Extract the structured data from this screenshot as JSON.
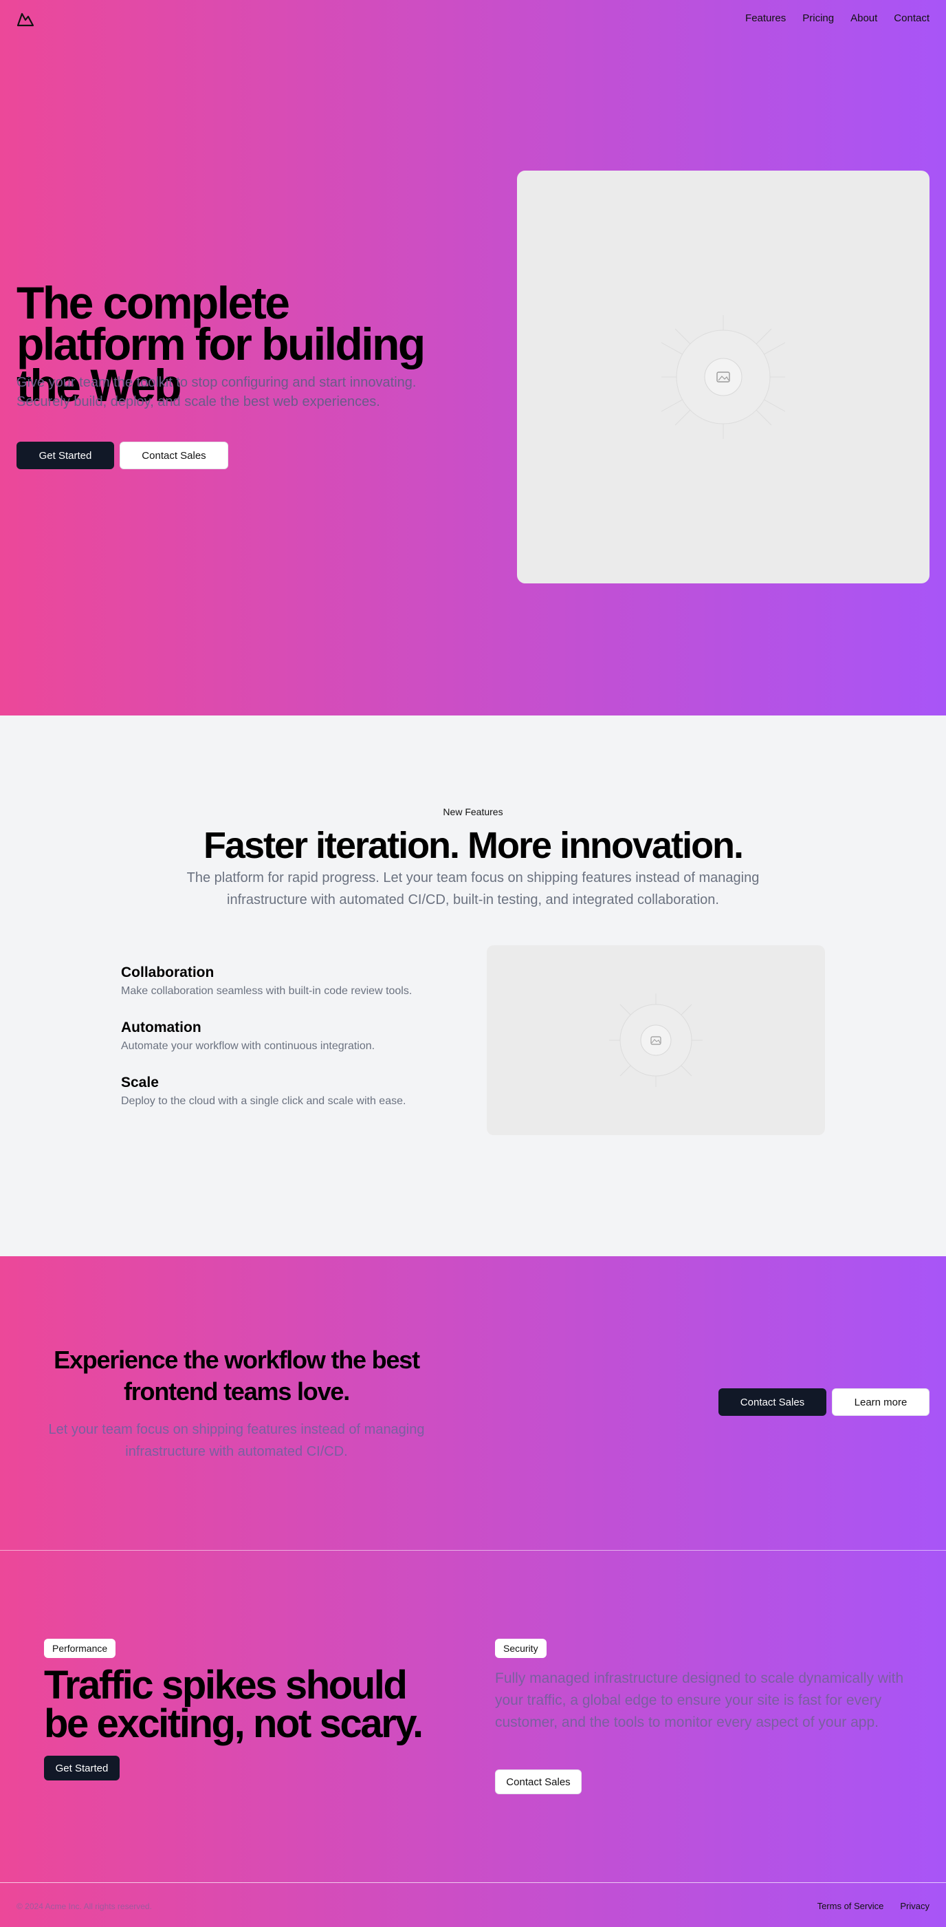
{
  "header": {
    "logo_icon": "mountain-logo-icon",
    "nav": [
      "Features",
      "Pricing",
      "About",
      "Contact"
    ]
  },
  "hero": {
    "title": "The complete platform for building the Web",
    "subtitle": "Give your team the toolkit to stop configuring and start innovating. Securely build, deploy, and scale the best web experiences.",
    "primary_button": "Get Started",
    "secondary_button": "Contact Sales",
    "image_icon": "image-placeholder-icon"
  },
  "features": {
    "eyebrow": "New Features",
    "title": "Faster iteration. More innovation.",
    "subtitle": "The platform for rapid progress. Let your team focus on shipping features instead of managing infrastructure with automated CI/CD, built-in testing, and integrated collaboration.",
    "items": [
      {
        "title": "Collaboration",
        "description": "Make collaboration seamless with built-in code review tools."
      },
      {
        "title": "Automation",
        "description": "Automate your workflow with continuous integration."
      },
      {
        "title": "Scale",
        "description": "Deploy to the cloud with a single click and scale with ease."
      }
    ],
    "image_icon": "image-placeholder-icon"
  },
  "cta": {
    "title": "Experience the workflow the best frontend teams love.",
    "subtitle": "Let your team focus on shipping features instead of managing infrastructure with automated CI/CD.",
    "primary_button": "Contact Sales",
    "secondary_button": "Learn more"
  },
  "perf": {
    "badge_left": "Performance",
    "title": "Traffic spikes should be exciting, not scary.",
    "button_left": "Get Started",
    "badge_right": "Security",
    "subtitle": "Fully managed infrastructure designed to scale dynamically with your traffic, a global edge to ensure your site is fast for every customer, and the tools to monitor every aspect of your app.",
    "button_right": "Contact Sales"
  },
  "footer": {
    "copyright": "© 2024 Acme Inc. All rights reserved.",
    "links": [
      "Terms of Service",
      "Privacy"
    ]
  },
  "colors": {
    "gradient_start": "#ec4899",
    "gradient_end": "#a855f7",
    "dark_button": "#111827",
    "section_bg": "#f3f4f6",
    "placeholder_bg": "#ebebeb"
  }
}
